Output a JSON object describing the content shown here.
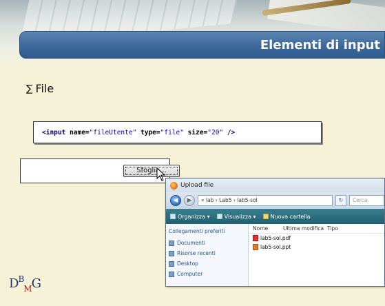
{
  "header": {
    "title": "Elementi di input"
  },
  "bullet": {
    "glyph": "∑",
    "text": "File"
  },
  "code": {
    "open": "<input",
    "attr1": " name=",
    "val1": "\"fileUtente\"",
    "attr2": " type=",
    "val2": "\"file\"",
    "attr3": " size=",
    "val3": "\"20\"",
    "close": " />"
  },
  "file_input": {
    "button_label": "Sfoglia..."
  },
  "dialog": {
    "title": "Upload file",
    "back_glyph": "◀",
    "forward_glyph": "▶",
    "address": "« lab › Lab5 › lab5-sol",
    "refresh_glyph": "↻",
    "search_placeholder": "Cerca",
    "toolbar": {
      "organize": "Organizza ▾",
      "views": "Visualizza ▾",
      "new_folder": "Nuova cartella"
    },
    "sidebar": {
      "heading": "Collegamenti preferiti",
      "items": [
        {
          "label": "Documenti"
        },
        {
          "label": "Risorse recenti"
        },
        {
          "label": "Desktop"
        },
        {
          "label": "Computer"
        }
      ]
    },
    "columns": {
      "name": "Nome",
      "modified": "Ultima modifica",
      "type": "Tipo"
    },
    "files": [
      {
        "name": "lab5-sol.pdf",
        "icon": "pdf-icon"
      },
      {
        "name": "lab5-sol.ppt",
        "icon": "ppt-icon"
      }
    ]
  },
  "logo": {
    "d": "D",
    "b": "B",
    "m": "M",
    "g": "G"
  }
}
